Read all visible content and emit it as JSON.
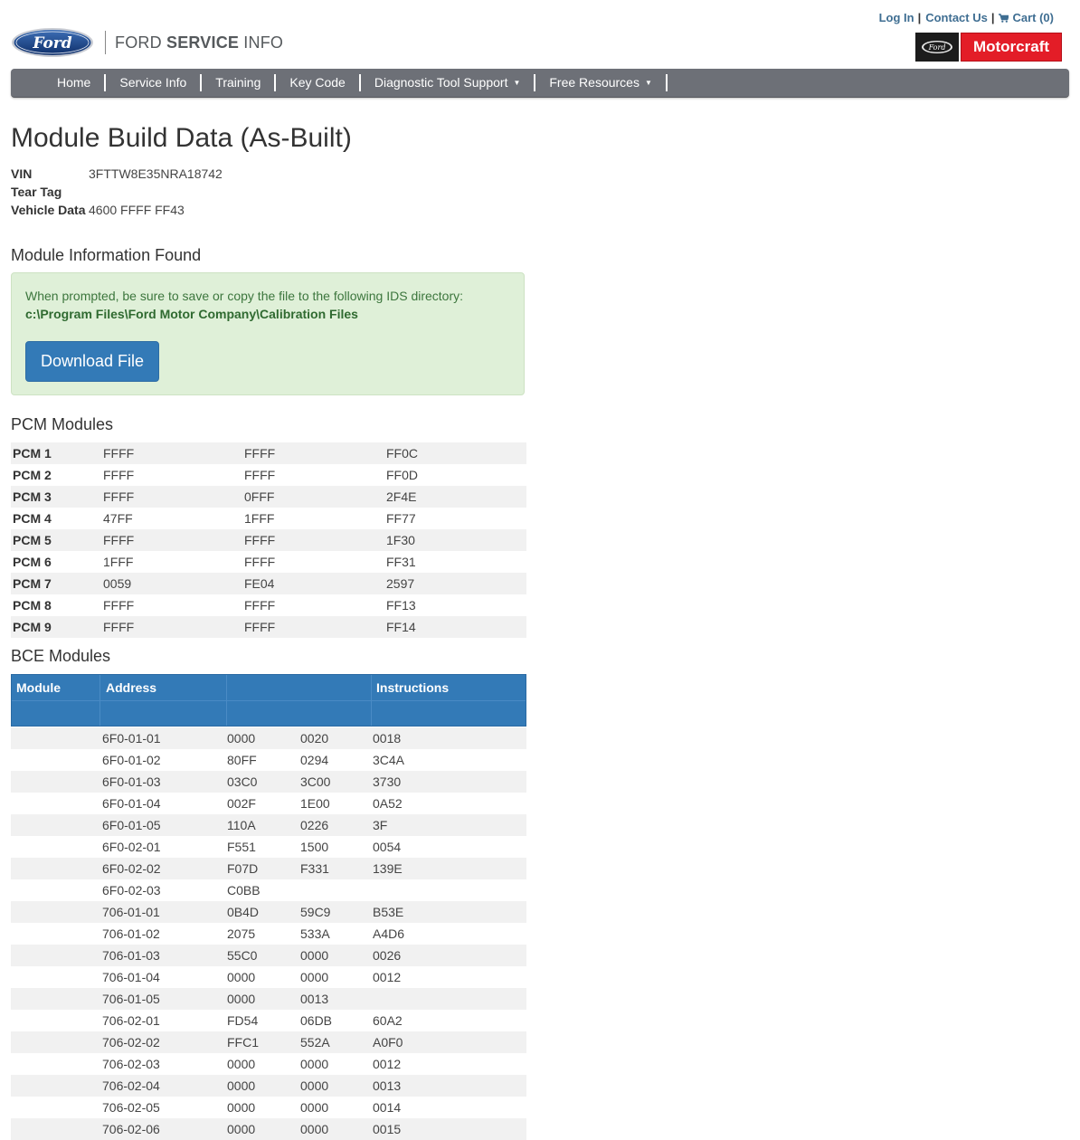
{
  "header": {
    "brand_light": "FORD ",
    "brand_bold": "SERVICE",
    "brand_tail": " INFO",
    "oval_text": "Ford",
    "top_links": {
      "login": "Log In",
      "contact": "Contact Us",
      "cart": "Cart (0)",
      "separator": "|"
    },
    "motorcraft": {
      "ford_text": "Ford",
      "label": "Motorcraft"
    }
  },
  "nav": {
    "items": [
      {
        "label": "Home"
      },
      {
        "label": "Service Info"
      },
      {
        "label": "Training"
      },
      {
        "label": "Key Code"
      },
      {
        "label": "Diagnostic Tool Support",
        "dropdown": true
      },
      {
        "label": "Free Resources",
        "dropdown": true
      }
    ],
    "caret": "▼"
  },
  "page": {
    "title": "Module Build Data (As-Built)",
    "vin_label": "VIN",
    "vin_value": "3FTTW8E35NRA18742",
    "tear_tag_label": "Tear Tag",
    "tear_tag_value": "",
    "vehicle_data_label": "Vehicle Data",
    "vehicle_data_value": "4600 FFFF FF43"
  },
  "module_info": {
    "heading": "Module Information Found",
    "message": "When prompted, be sure to save or copy the file to the following IDS directory:",
    "path": "c:\\Program Files\\Ford Motor Company\\Calibration Files",
    "download_label": "Download File"
  },
  "pcm": {
    "heading": "PCM Modules",
    "rows": [
      [
        "PCM 1",
        "FFFF",
        "FFFF",
        "FF0C"
      ],
      [
        "PCM 2",
        "FFFF",
        "FFFF",
        "FF0D"
      ],
      [
        "PCM 3",
        "FFFF",
        "0FFF",
        "2F4E"
      ],
      [
        "PCM 4",
        "47FF",
        "1FFF",
        "FF77"
      ],
      [
        "PCM 5",
        "FFFF",
        "FFFF",
        "1F30"
      ],
      [
        "PCM 6",
        "1FFF",
        "FFFF",
        "FF31"
      ],
      [
        "PCM 7",
        "0059",
        "FE04",
        "2597"
      ],
      [
        "PCM 8",
        "FFFF",
        "FFFF",
        "FF13"
      ],
      [
        "PCM 9",
        "FFFF",
        "FFFF",
        "FF14"
      ]
    ]
  },
  "bce": {
    "heading": "BCE Modules",
    "columns": {
      "module": "Module",
      "address": "Address",
      "instructions": "Instructions"
    },
    "rows": [
      [
        "",
        "6F0-01-01",
        "0000",
        "0020",
        "0018"
      ],
      [
        "",
        "6F0-01-02",
        "80FF",
        "0294",
        "3C4A"
      ],
      [
        "",
        "6F0-01-03",
        "03C0",
        "3C00",
        "3730"
      ],
      [
        "",
        "6F0-01-04",
        "002F",
        "1E00",
        "0A52"
      ],
      [
        "",
        "6F0-01-05",
        "110A",
        "0226",
        "3F"
      ],
      [
        "",
        "6F0-02-01",
        "F551",
        "1500",
        "0054"
      ],
      [
        "",
        "6F0-02-02",
        "F07D",
        "F331",
        "139E"
      ],
      [
        "",
        "6F0-02-03",
        "C0BB",
        "",
        ""
      ],
      [
        "",
        "706-01-01",
        "0B4D",
        "59C9",
        "B53E"
      ],
      [
        "",
        "706-01-02",
        "2075",
        "533A",
        "A4D6"
      ],
      [
        "",
        "706-01-03",
        "55C0",
        "0000",
        "0026"
      ],
      [
        "",
        "706-01-04",
        "0000",
        "0000",
        "0012"
      ],
      [
        "",
        "706-01-05",
        "0000",
        "0013",
        ""
      ],
      [
        "",
        "706-02-01",
        "FD54",
        "06DB",
        "60A2"
      ],
      [
        "",
        "706-02-02",
        "FFC1",
        "552A",
        "A0F0"
      ],
      [
        "",
        "706-02-03",
        "0000",
        "0000",
        "0012"
      ],
      [
        "",
        "706-02-04",
        "0000",
        "0000",
        "0013"
      ],
      [
        "",
        "706-02-05",
        "0000",
        "0000",
        "0014"
      ],
      [
        "",
        "706-02-06",
        "0000",
        "0000",
        "0015"
      ]
    ]
  },
  "colors": {
    "nav_bg": "#6d7077",
    "link": "#3f6e92",
    "primary": "#337ab7",
    "alert_bg": "#dff0d8",
    "motorcraft_red": "#e31d27"
  }
}
